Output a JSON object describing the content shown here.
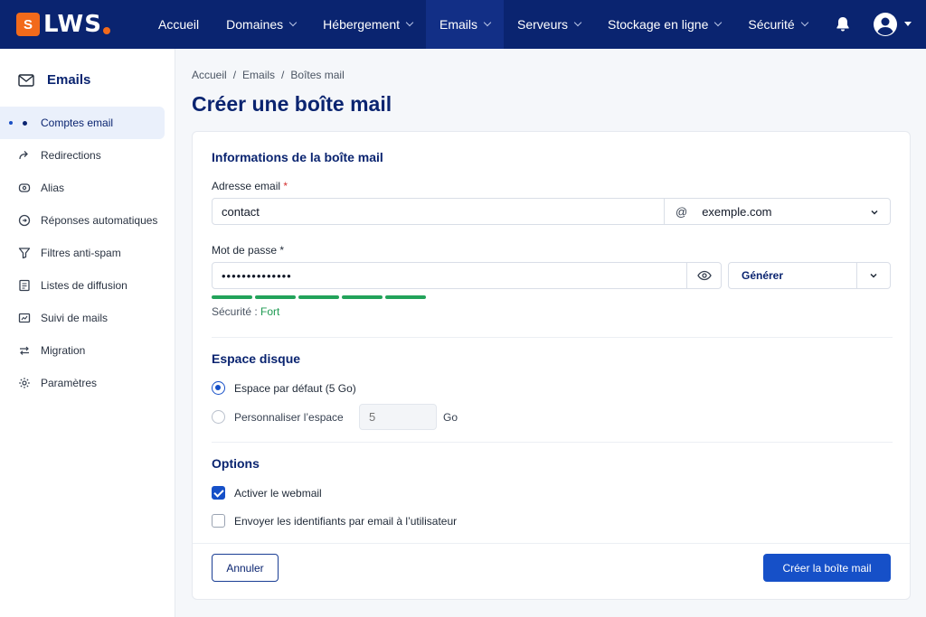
{
  "brand": {
    "logo_text": "LWS",
    "logo_mark": "S"
  },
  "nav": {
    "items": [
      {
        "label": "Accueil",
        "dropdown": false
      },
      {
        "label": "Domaines",
        "dropdown": true
      },
      {
        "label": "Hébergement",
        "dropdown": true
      },
      {
        "label": "Emails",
        "dropdown": true,
        "active": true
      },
      {
        "label": "Serveurs",
        "dropdown": true
      },
      {
        "label": "Stockage en ligne",
        "dropdown": true
      },
      {
        "label": "Sécurité",
        "dropdown": true
      }
    ],
    "icons": [
      "bell-icon",
      "user-icon"
    ]
  },
  "sidebar": {
    "title": "Emails",
    "items": [
      {
        "label": "Comptes email",
        "icon": "dot-icon",
        "active": true
      },
      {
        "label": "Redirections",
        "icon": "forward-icon"
      },
      {
        "label": "Alias",
        "icon": "alias-icon"
      },
      {
        "label": "Réponses automatiques",
        "icon": "auto-reply-icon"
      },
      {
        "label": "Filtres anti-spam",
        "icon": "filter-icon"
      },
      {
        "label": "Listes de diffusion",
        "icon": "list-icon"
      },
      {
        "label": "Suivi de mails",
        "icon": "tracking-icon"
      },
      {
        "label": "Migration",
        "icon": "migration-icon"
      },
      {
        "label": "Paramètres",
        "icon": "gear-icon"
      }
    ]
  },
  "breadcrumb": [
    "Accueil",
    "/",
    "Emails",
    "/",
    "Boîtes mail"
  ],
  "page": {
    "title": "Créer une boîte mail"
  },
  "form": {
    "section_info": "Informations de la boîte mail",
    "email_label": "Adresse email",
    "email_required": "*",
    "email_value": "contact",
    "at_sign": "@",
    "domain_value": "exemple.com",
    "password_label": "Mot de passe *",
    "password_value": "••••••••••••••",
    "generate_label": "Générer",
    "strength_prefix": "Sécurité : ",
    "strength_value": "Fort",
    "strength_segments": 5,
    "section_disk": "Espace disque",
    "disk_default_label": "Espace par défaut (5 Go)",
    "disk_custom_label": "Personnaliser l’espace",
    "disk_custom_placeholder": "5",
    "disk_unit": "Go",
    "disk_selected": "default",
    "section_options": "Options",
    "opt_webmail_label": "Activer le webmail",
    "opt_webmail_checked": true,
    "opt_send_label": "Envoyer les identifiants par email à l’utilisateur",
    "opt_send_checked": false
  },
  "actions": {
    "cancel": "Annuler",
    "create": "Créer la boîte mail"
  },
  "colors": {
    "nav_bg": "#0a2470",
    "accent": "#1650c8",
    "logo_orange": "#f26a1b",
    "strength_green": "#22a35a"
  }
}
